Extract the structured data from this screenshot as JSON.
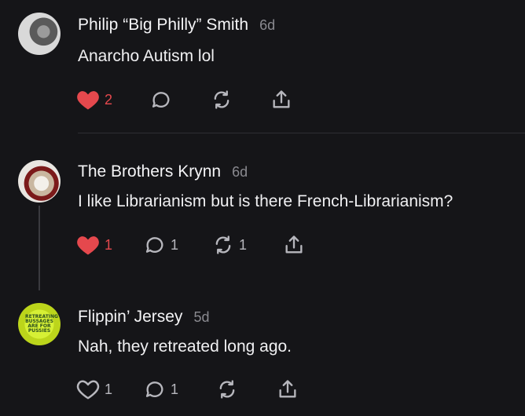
{
  "comments": [
    {
      "author": "Philip “Big Philly” Smith",
      "time": "6d",
      "text": "Anarcho Autism lol",
      "likes": "2",
      "liked": true,
      "replies": "",
      "reposts": ""
    },
    {
      "author": "The Brothers Krynn",
      "time": "6d",
      "text": "I like Librarianism but is there French-Librarianism?",
      "likes": "1",
      "liked": true,
      "replies": "1",
      "reposts": "1"
    },
    {
      "author": "Flippin’ Jersey",
      "time": "5d",
      "text": "Nah, they retreated long ago.",
      "likes": "1",
      "liked": false,
      "replies": "1",
      "reposts": ""
    }
  ],
  "avatar3_text": "RETREATING BUSSAGES ARE FOR PUSSIES",
  "colors": {
    "background": "#151518",
    "liked_heart": "#e5484d",
    "icon": "#b7b7bd",
    "divider": "#2e2e33"
  },
  "icons": [
    "heart-icon",
    "reply-bubble-icon",
    "repost-icon",
    "share-icon"
  ]
}
